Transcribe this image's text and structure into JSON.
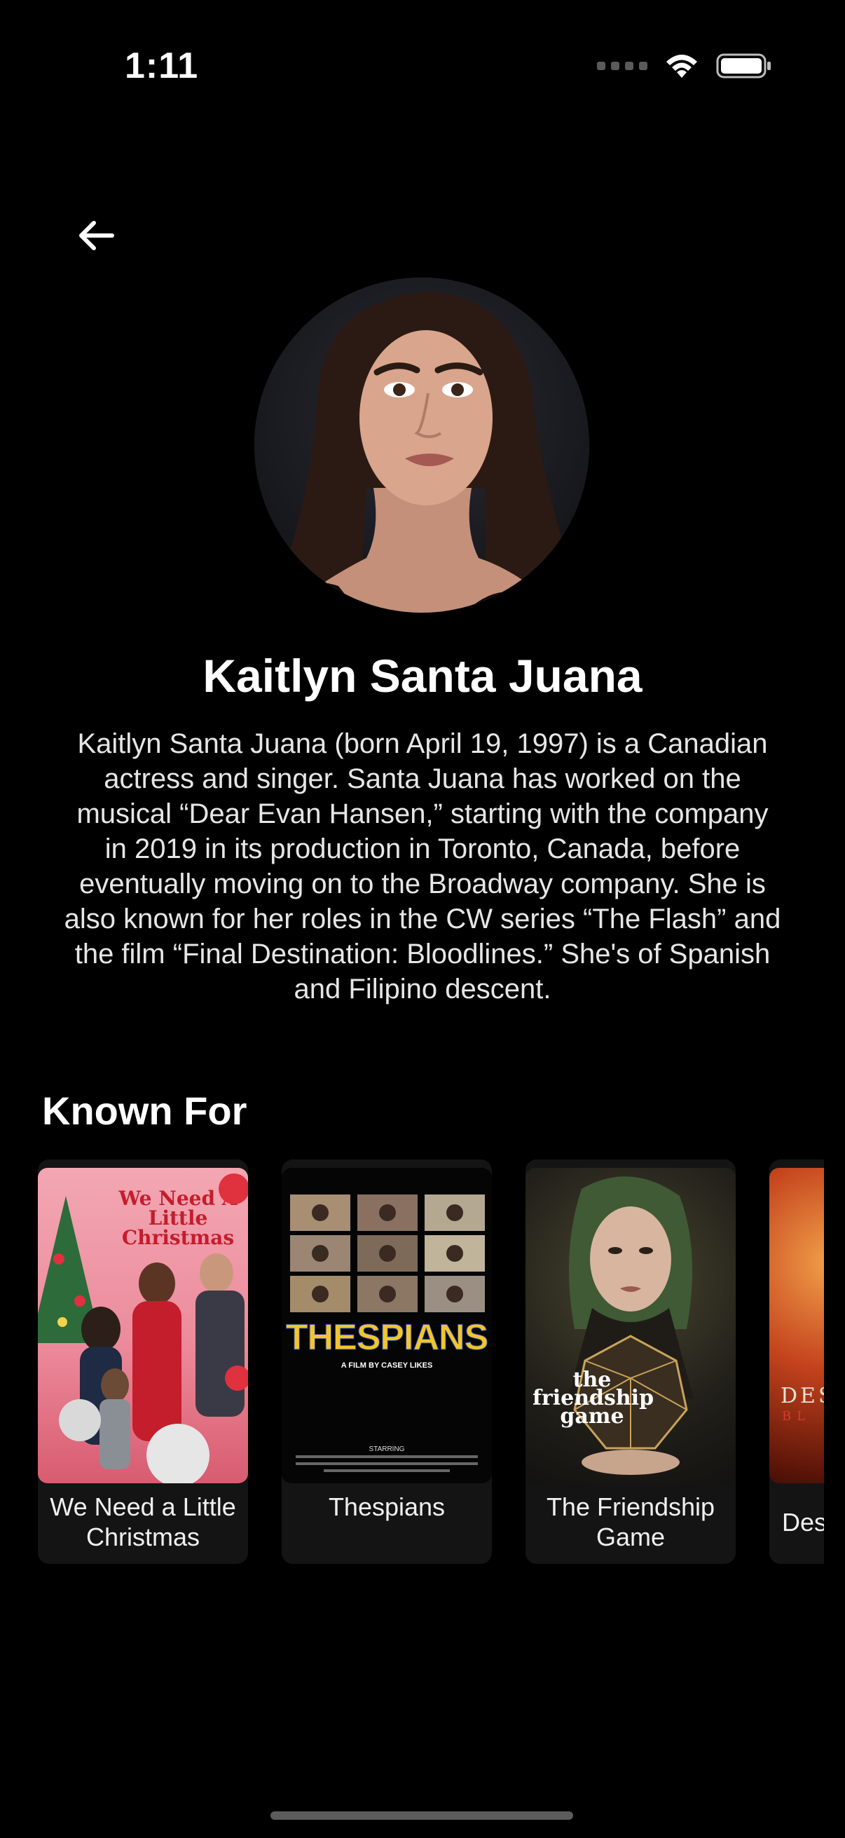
{
  "status_bar": {
    "time": "1:11"
  },
  "profile": {
    "name": "Kaitlyn Santa Juana",
    "bio": "Kaitlyn Santa Juana (born April 19, 1997) is a Canadian actress and singer. Santa Juana has worked on the musical “Dear Evan Hansen,” starting with the company in 2019 in its production in Toronto, Canada, before eventually moving on to the Broadway company. She is also known for her roles in the CW series “The Flash” and the film “Final Destination: Bloodlines.” She's of Spanish and Filipino descent."
  },
  "known_for": {
    "title": "Known For",
    "items": [
      {
        "title": "We Need a Little Christmas",
        "poster_text": "We Need A Little Christmas"
      },
      {
        "title": "Thespians",
        "poster_text": "THESPIANS",
        "poster_sub": "A FILM BY CASEY LIKES",
        "poster_credits": "STARRING"
      },
      {
        "title": "The Friendship Game",
        "poster_text": "the friendship game"
      },
      {
        "title": "Des",
        "poster_text": "DES",
        "poster_sub": "BL"
      }
    ]
  },
  "colors": {
    "background": "#000000",
    "card": "#141414",
    "text": "#ffffff"
  },
  "icons": {
    "back": "arrow-left-icon",
    "wifi": "wifi-icon",
    "battery": "battery-icon",
    "signal": "cellular-signal-icon"
  }
}
